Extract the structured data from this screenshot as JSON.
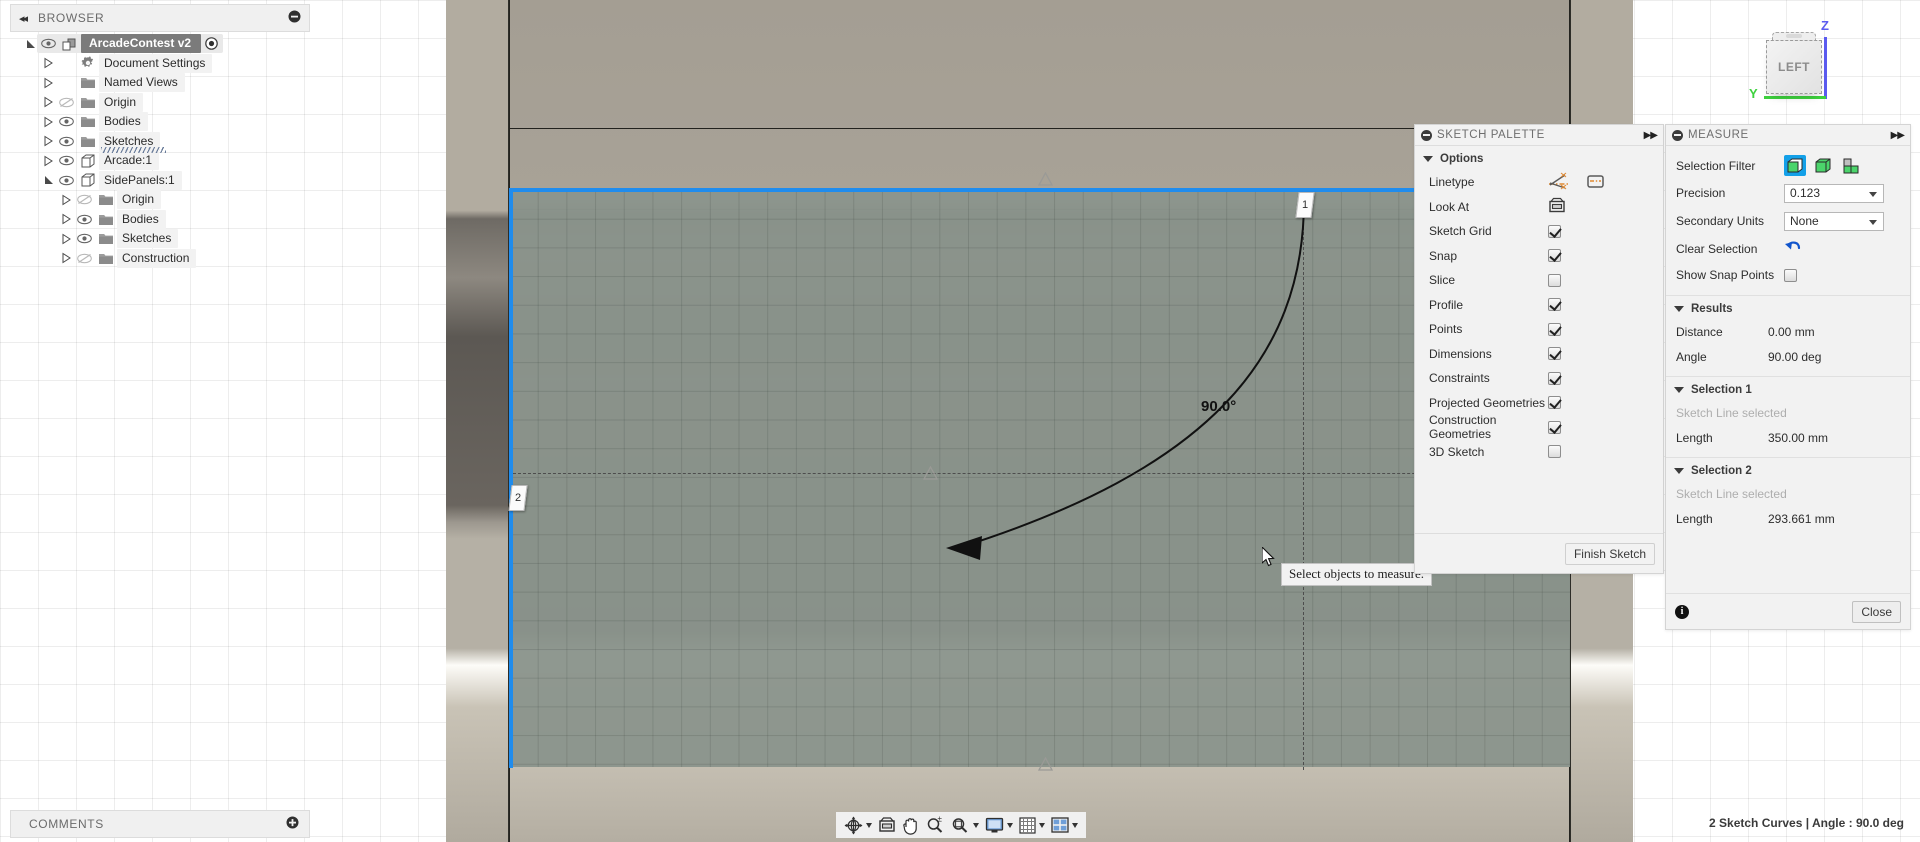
{
  "browser": {
    "header_title": "BROWSER",
    "collapse_icon": "collapse-left-arrows-icon",
    "add_icon": "minus-circle-icon",
    "root": {
      "label": "ArcadeContest v2",
      "icon": "assembly-icon",
      "radio_icon": "radio-dot-icon",
      "expanded": true
    },
    "items": [
      {
        "label": "Document Settings",
        "icon": "gear-icon",
        "indent": 1,
        "expanded": false,
        "eye": "none",
        "visible": true
      },
      {
        "label": "Named Views",
        "icon": "folder-icon",
        "indent": 1,
        "expanded": false,
        "eye": "none",
        "visible": true
      },
      {
        "label": "Origin",
        "icon": "folder-icon",
        "indent": 1,
        "expanded": false,
        "eye": "hidden",
        "visible": false
      },
      {
        "label": "Bodies",
        "icon": "folder-icon",
        "indent": 1,
        "expanded": false,
        "eye": "visible",
        "visible": true
      },
      {
        "label": "Sketches",
        "icon": "folder-icon",
        "indent": 1,
        "expanded": false,
        "eye": "visible",
        "visible": true,
        "underlined": true
      },
      {
        "label": "Arcade:1",
        "icon": "component-icon",
        "indent": 1,
        "expanded": false,
        "eye": "visible",
        "visible": true
      },
      {
        "label": "SidePanels:1",
        "icon": "component-icon",
        "indent": 1,
        "expanded": true,
        "eye": "visible",
        "visible": true
      },
      {
        "label": "Origin",
        "icon": "folder-icon",
        "indent": 2,
        "expanded": false,
        "eye": "hidden",
        "visible": false
      },
      {
        "label": "Bodies",
        "icon": "folder-icon",
        "indent": 2,
        "expanded": false,
        "eye": "visible",
        "visible": true
      },
      {
        "label": "Sketches",
        "icon": "folder-icon",
        "indent": 2,
        "expanded": false,
        "eye": "visible",
        "visible": true
      },
      {
        "label": "Construction",
        "icon": "folder-icon",
        "indent": 2,
        "expanded": false,
        "eye": "hidden",
        "visible": false
      }
    ]
  },
  "comments": {
    "title": "COMMENTS",
    "add_icon": "plus-circle-icon"
  },
  "canvas": {
    "angle_label": "90.0°",
    "selection_flag_1": "1",
    "selection_flag_2": "2",
    "tooltip": "Select objects to measure.",
    "cursor_icon": "arrow-cursor-icon",
    "selected_edge_color": "#1f8ced",
    "sketch_face_color": "#8c958d",
    "viewcube": {
      "face_label": "LEFT",
      "axis_z_label": "Z",
      "axis_y_label": "Y",
      "axis_z_color": "#5b5bf0",
      "axis_y_color": "#3ed23e"
    }
  },
  "sketch_palette": {
    "title": "SKETCH PALETTE",
    "collapse_icon": "minus-circle-icon",
    "expand_icon": "double-chevron-right-icon",
    "section_options": "Options",
    "rows": [
      {
        "label": "Linetype",
        "type": "icons",
        "icons": [
          "centerline-icon",
          "construction-rect-icon"
        ]
      },
      {
        "label": "Look At",
        "type": "icon",
        "icons": [
          "look-at-icon"
        ]
      },
      {
        "label": "Sketch Grid",
        "type": "checkbox",
        "checked": true
      },
      {
        "label": "Snap",
        "type": "checkbox",
        "checked": true
      },
      {
        "label": "Slice",
        "type": "checkbox",
        "checked": false
      },
      {
        "label": "Profile",
        "type": "checkbox",
        "checked": true
      },
      {
        "label": "Points",
        "type": "checkbox",
        "checked": true
      },
      {
        "label": "Dimensions",
        "type": "checkbox",
        "checked": true
      },
      {
        "label": "Constraints",
        "type": "checkbox",
        "checked": true
      },
      {
        "label": "Projected Geometries",
        "type": "checkbox",
        "checked": true
      },
      {
        "label": "Construction Geometries",
        "type": "checkbox",
        "checked": true
      },
      {
        "label": "3D Sketch",
        "type": "checkbox",
        "checked": false
      }
    ],
    "finish_button": "Finish Sketch"
  },
  "measure": {
    "title": "MEASURE",
    "collapse_icon": "minus-circle-icon",
    "expand_icon": "double-chevron-right-icon",
    "selection_filter": {
      "label": "Selection Filter",
      "options": [
        "select-face-icon",
        "select-body-icon",
        "select-component-icon"
      ],
      "active_index": 0,
      "active_color": "#13a0e8"
    },
    "precision": {
      "label": "Precision",
      "value": "0.123"
    },
    "secondary_units": {
      "label": "Secondary Units",
      "value": "None"
    },
    "clear_selection": {
      "label": "Clear Selection",
      "icon": "undo-arrow-icon"
    },
    "show_snap_points": {
      "label": "Show Snap Points",
      "checked": false
    },
    "results": {
      "title": "Results",
      "rows": [
        {
          "label": "Distance",
          "value": "0.00 mm"
        },
        {
          "label": "Angle",
          "value": "90.00 deg"
        }
      ]
    },
    "selection_1": {
      "title": "Selection 1",
      "status": "Sketch Line selected",
      "rows": [
        {
          "label": "Length",
          "value": "350.00 mm"
        }
      ]
    },
    "selection_2": {
      "title": "Selection 2",
      "status": "Sketch Line selected",
      "rows": [
        {
          "label": "Length",
          "value": "293.661 mm"
        }
      ]
    },
    "info_icon": "info-icon",
    "close_button": "Close"
  },
  "nav_toolbar": {
    "items": [
      {
        "name": "orbit-icon",
        "has_caret": true
      },
      {
        "name": "look-at-icon",
        "has_caret": false
      },
      {
        "name": "pan-hand-icon",
        "has_caret": false
      },
      {
        "name": "zoom-icon",
        "has_caret": false
      },
      {
        "name": "zoom-window-icon",
        "has_caret": true
      },
      {
        "name": "display-settings-icon",
        "has_caret": true
      },
      {
        "name": "grid-snaps-icon",
        "has_caret": true
      },
      {
        "name": "viewports-icon",
        "has_caret": true
      }
    ]
  },
  "status_bar": {
    "text": "2 Sketch Curves | Angle : 90.0 deg"
  }
}
